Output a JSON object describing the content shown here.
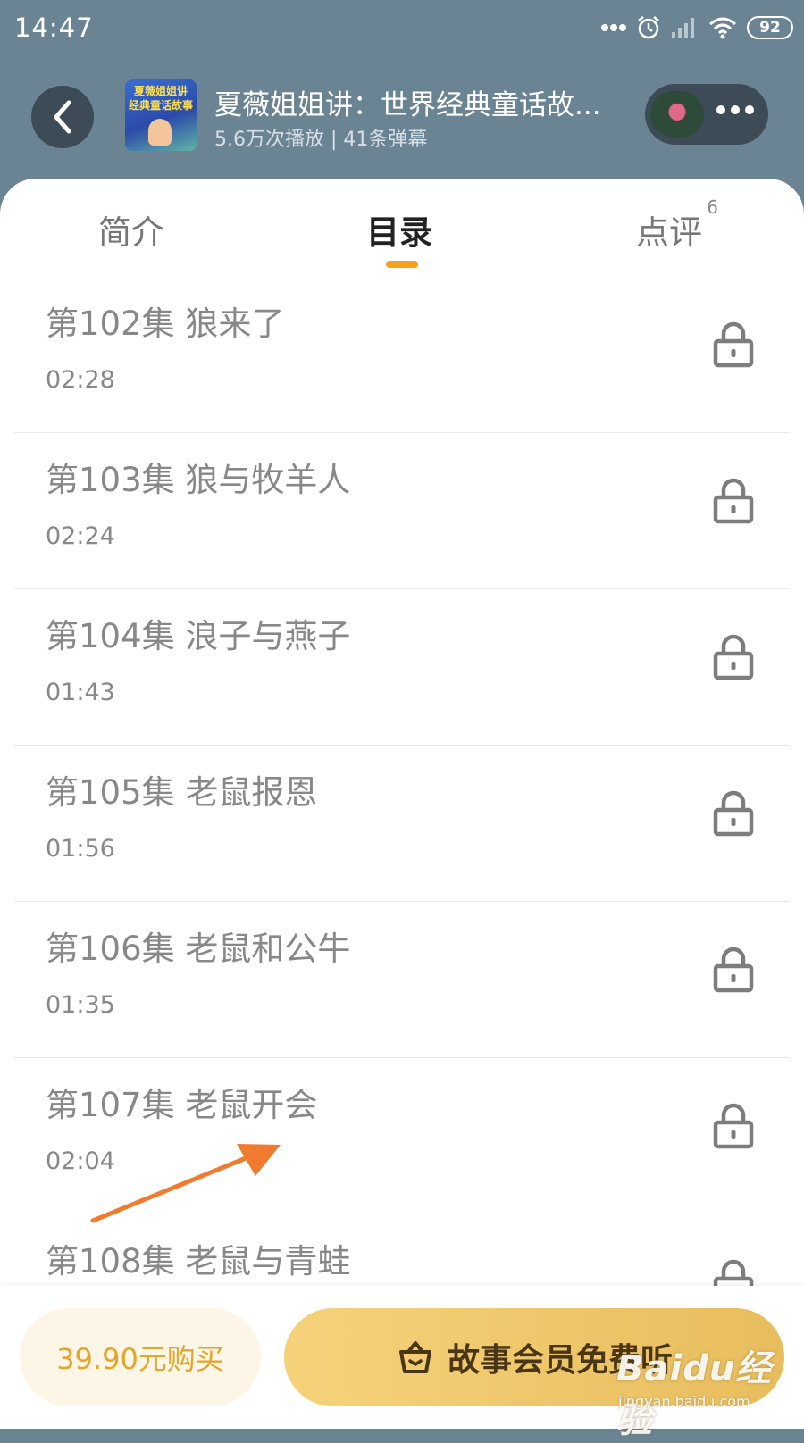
{
  "status_bar": {
    "time": "14:47",
    "battery": "92"
  },
  "header": {
    "cover_lines": [
      "夏薇姐姐讲",
      "经典童话故事"
    ],
    "title": "夏薇姐姐讲：世界经典童话故...",
    "meta": "5.6万次播放 | 41条弹幕"
  },
  "tabs": [
    {
      "label": "简介"
    },
    {
      "label": "目录"
    },
    {
      "label": "点评",
      "badge": "6"
    }
  ],
  "episodes": [
    {
      "title": "第102集 狼来了",
      "duration": "02:28"
    },
    {
      "title": "第103集 狼与牧羊人",
      "duration": "02:24"
    },
    {
      "title": "第104集 浪子与燕子",
      "duration": "01:43"
    },
    {
      "title": "第105集 老鼠报恩",
      "duration": "01:56"
    },
    {
      "title": "第106集 老鼠和公牛",
      "duration": "01:35"
    },
    {
      "title": "第107集 老鼠开会",
      "duration": "02:04"
    },
    {
      "title": "第108集 老鼠与青蛙",
      "duration": ""
    }
  ],
  "bottom": {
    "buy_label": "39.90元购买",
    "vip_label": "故事会员免费听"
  },
  "watermark": {
    "main": "Baidu经验",
    "sub": "jingyan.baidu.com"
  },
  "colors": {
    "accent": "#f5a11c",
    "header_bg": "#6b8494",
    "annotation_arrow": "#f07a2e"
  }
}
